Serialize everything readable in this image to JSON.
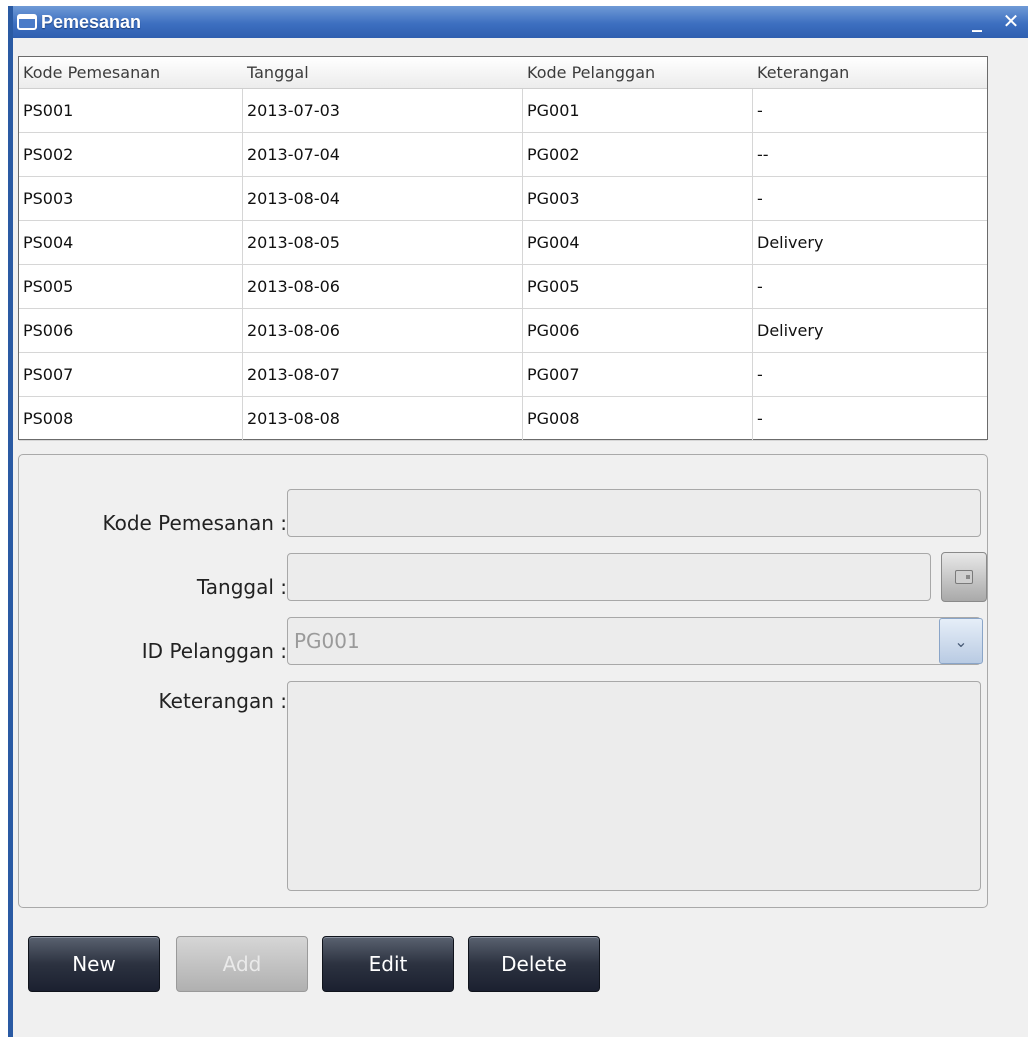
{
  "window": {
    "title": "Pemesanan",
    "minimize": "_",
    "close": "✕"
  },
  "table": {
    "headers": [
      "Kode Pemesanan",
      "Tanggal",
      "Kode Pelanggan",
      "Keterangan"
    ],
    "rows": [
      [
        "PS001",
        "2013-07-03",
        "PG001",
        "-"
      ],
      [
        "PS002",
        "2013-07-04",
        "PG002",
        "--"
      ],
      [
        "PS003",
        "2013-08-04",
        "PG003",
        "-"
      ],
      [
        "PS004",
        "2013-08-05",
        "PG004",
        "Delivery"
      ],
      [
        "PS005",
        "2013-08-06",
        "PG005",
        "-"
      ],
      [
        "PS006",
        "2013-08-06",
        "PG006",
        "Delivery"
      ],
      [
        "PS007",
        "2013-08-07",
        "PG007",
        "-"
      ],
      [
        "PS008",
        "2013-08-08",
        "PG008",
        "-"
      ]
    ]
  },
  "form": {
    "kode_label": "Kode Pemesanan :",
    "kode_value": "",
    "tanggal_label": "Tanggal :",
    "tanggal_value": "",
    "id_label": "ID Pelanggan :",
    "id_value": "PG001",
    "keterangan_label": "Keterangan :",
    "keterangan_value": ""
  },
  "buttons": {
    "new": "New",
    "add": "Add",
    "edit": "Edit",
    "delete": "Delete"
  }
}
